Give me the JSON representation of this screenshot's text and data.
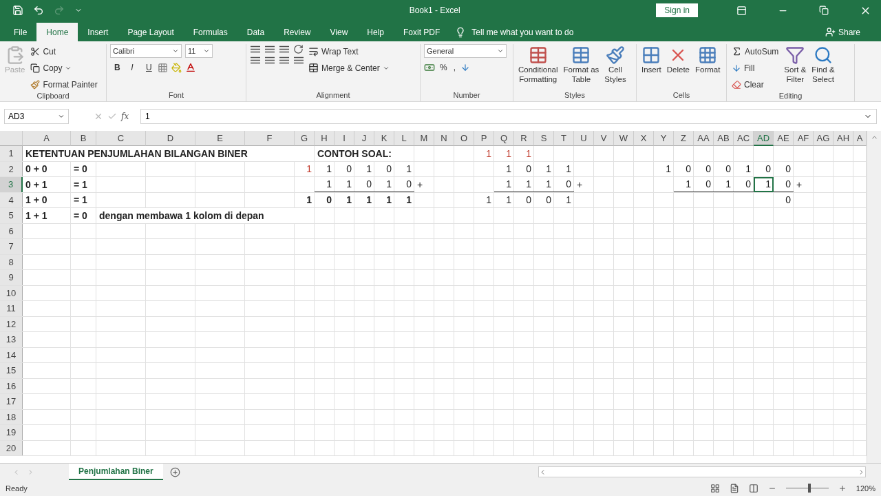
{
  "title_bar": {
    "title": "Book1  -  Excel",
    "sign_in": "Sign in"
  },
  "ribbon_tabs": [
    {
      "label": "File",
      "selected": false
    },
    {
      "label": "Home",
      "selected": true
    },
    {
      "label": "Insert",
      "selected": false
    },
    {
      "label": "Page Layout",
      "selected": false
    },
    {
      "label": "Formulas",
      "selected": false
    },
    {
      "label": "Data",
      "selected": false
    },
    {
      "label": "Review",
      "selected": false
    },
    {
      "label": "View",
      "selected": false
    },
    {
      "label": "Help",
      "selected": false
    },
    {
      "label": "Foxit PDF",
      "selected": false
    }
  ],
  "tell_me": "Tell me what you want to do",
  "share": "Share",
  "ribbon": {
    "clipboard": {
      "paste": {
        "label": "Paste",
        "disabled": true
      },
      "cut": "Cut",
      "copy": "Copy",
      "format_painter": "Format Painter",
      "label": "Clipboard"
    },
    "font": {
      "name": "Calibri",
      "size": "11",
      "bold": "B",
      "italic": "I",
      "underline": "U",
      "label": "Font"
    },
    "alignment": {
      "wrap_text": "Wrap Text",
      "merge_center": "Merge & Center",
      "label": "Alignment"
    },
    "number": {
      "format": "General",
      "percent": "%",
      "comma": ",",
      "label": "Number"
    },
    "styles": {
      "buttons": [
        {
          "lines": [
            "Conditional",
            "Formatting"
          ],
          "kind": "conditional"
        },
        {
          "lines": [
            "Format as",
            "Table"
          ],
          "kind": "table"
        },
        {
          "lines": [
            "Cell",
            "Styles"
          ],
          "kind": "styles"
        }
      ],
      "label": "Styles"
    },
    "cells": {
      "buttons": [
        {
          "lines": [
            "Insert"
          ],
          "kind": "insert"
        },
        {
          "lines": [
            "Delete"
          ],
          "kind": "delete"
        },
        {
          "lines": [
            "Format"
          ],
          "kind": "format"
        }
      ],
      "label": "Cells"
    },
    "editing": {
      "autosum": "AutoSum",
      "fill": "Fill",
      "clear": "Clear",
      "buttons": [
        {
          "lines": [
            "Sort &",
            "Filter"
          ],
          "kind": "sort"
        },
        {
          "lines": [
            "Find &",
            "Select"
          ],
          "kind": "find"
        }
      ],
      "label": "Editing"
    }
  },
  "formula_bar": {
    "name_box": "AD3",
    "function_label": "fx",
    "value": "1"
  },
  "sheet": {
    "columns": [
      {
        "label": "A",
        "selected": false
      },
      {
        "label": "B",
        "selected": false
      },
      {
        "label": "C",
        "selected": false
      },
      {
        "label": "D",
        "selected": false
      },
      {
        "label": "E",
        "selected": false
      },
      {
        "label": "F",
        "selected": false
      },
      {
        "label": "G",
        "selected": false
      },
      {
        "label": "H",
        "selected": false
      },
      {
        "label": "I",
        "selected": false
      },
      {
        "label": "J",
        "selected": false
      },
      {
        "label": "K",
        "selected": false
      },
      {
        "label": "L",
        "selected": false
      },
      {
        "label": "M",
        "selected": false
      },
      {
        "label": "N",
        "selected": false
      },
      {
        "label": "O",
        "selected": false
      },
      {
        "label": "P",
        "selected": false
      },
      {
        "label": "Q",
        "selected": false
      },
      {
        "label": "R",
        "selected": false
      },
      {
        "label": "S",
        "selected": false
      },
      {
        "label": "T",
        "selected": false
      },
      {
        "label": "U",
        "selected": false
      },
      {
        "label": "V",
        "selected": false
      },
      {
        "label": "W",
        "selected": false
      },
      {
        "label": "X",
        "selected": false
      },
      {
        "label": "Y",
        "selected": false
      },
      {
        "label": "Z",
        "selected": false
      },
      {
        "label": "AA",
        "selected": false
      },
      {
        "label": "AB",
        "selected": false
      },
      {
        "label": "AC",
        "selected": false
      },
      {
        "label": "AD",
        "selected": true
      },
      {
        "label": "AE",
        "selected": false
      },
      {
        "label": "AF",
        "selected": false
      },
      {
        "label": "AG",
        "selected": false
      },
      {
        "label": "AH",
        "selected": false
      },
      {
        "label": "A",
        "selected": false
      }
    ],
    "rows": [
      {
        "number": "1",
        "selected": false,
        "cells": [
          {
            "text": "KETENTUAN PENJUMLAHAN BILANGAN BINER",
            "kind": "text",
            "bold": true,
            "carry": false,
            "selected": false
          },
          {
            "text": "CONTOH SOAL:",
            "kind": "text",
            "bold": true,
            "carry": false,
            "selected": false
          },
          {
            "text": "1",
            "kind": "number",
            "bold": false,
            "carry": true,
            "selected": false
          },
          {
            "text": "1",
            "kind": "number",
            "bold": false,
            "carry": true,
            "selected": false
          },
          {
            "text": "1",
            "kind": "number",
            "bold": false,
            "carry": true,
            "selected": false
          }
        ]
      },
      {
        "number": "2",
        "selected": false,
        "cells": [
          {
            "text": "0 + 0",
            "kind": "text",
            "bold": true,
            "carry": false,
            "selected": false
          },
          {
            "text": "= 0",
            "kind": "text",
            "bold": true,
            "carry": false,
            "selected": false
          },
          {
            "text": "1",
            "kind": "number",
            "bold": false,
            "carry": true,
            "selected": false
          },
          {
            "text": "1",
            "kind": "number",
            "bold": false,
            "carry": false,
            "selected": false
          },
          {
            "text": "0",
            "kind": "number",
            "bold": false,
            "carry": false,
            "selected": false
          },
          {
            "text": "1",
            "kind": "number",
            "bold": false,
            "carry": false,
            "selected": false
          },
          {
            "text": "0",
            "kind": "number",
            "bold": false,
            "carry": false,
            "selected": false
          },
          {
            "text": "1",
            "kind": "number",
            "bold": false,
            "carry": false,
            "selected": false
          },
          {
            "text": "1",
            "kind": "number",
            "bold": false,
            "carry": false,
            "selected": false
          },
          {
            "text": "0",
            "kind": "number",
            "bold": false,
            "carry": false,
            "selected": false
          },
          {
            "text": "1",
            "kind": "number",
            "bold": false,
            "carry": false,
            "selected": false
          },
          {
            "text": "1",
            "kind": "number",
            "bold": false,
            "carry": false,
            "selected": false
          },
          {
            "text": "1",
            "kind": "number",
            "bold": false,
            "carry": false,
            "selected": false
          },
          {
            "text": "0",
            "kind": "number",
            "bold": false,
            "carry": false,
            "selected": false
          },
          {
            "text": "0",
            "kind": "number",
            "bold": false,
            "carry": false,
            "selected": false
          },
          {
            "text": "0",
            "kind": "number",
            "bold": false,
            "carry": false,
            "selected": false
          },
          {
            "text": "1",
            "kind": "number",
            "bold": false,
            "carry": false,
            "selected": false
          },
          {
            "text": "0",
            "kind": "number",
            "bold": false,
            "carry": false,
            "selected": false
          },
          {
            "text": "0",
            "kind": "number",
            "bold": false,
            "carry": false,
            "selected": false
          }
        ]
      },
      {
        "number": "3",
        "selected": true,
        "cells": [
          {
            "text": "0 + 1",
            "kind": "text",
            "bold": true,
            "carry": false,
            "selected": false,
            "underlined": false
          },
          {
            "text": "= 1",
            "kind": "text",
            "bold": true,
            "carry": false,
            "selected": false,
            "underlined": false
          },
          {
            "text": "1",
            "kind": "number",
            "bold": false,
            "carry": false,
            "selected": false,
            "underlined": true
          },
          {
            "text": "1",
            "kind": "number",
            "bold": false,
            "carry": false,
            "selected": false,
            "underlined": true
          },
          {
            "text": "0",
            "kind": "number",
            "bold": false,
            "carry": false,
            "selected": false,
            "underlined": true
          },
          {
            "text": "1",
            "kind": "number",
            "bold": false,
            "carry": false,
            "selected": false,
            "underlined": true
          },
          {
            "text": "0",
            "kind": "number",
            "bold": false,
            "carry": false,
            "selected": false,
            "underlined": true
          },
          {
            "text": "+",
            "kind": "text",
            "bold": false,
            "carry": false,
            "selected": false,
            "underlined": false
          },
          {
            "text": "1",
            "kind": "number",
            "bold": false,
            "carry": false,
            "selected": false,
            "underlined": true
          },
          {
            "text": "1",
            "kind": "number",
            "bold": false,
            "carry": false,
            "selected": false,
            "underlined": true
          },
          {
            "text": "1",
            "kind": "number",
            "bold": false,
            "carry": false,
            "selected": false,
            "underlined": true
          },
          {
            "text": "0",
            "kind": "number",
            "bold": false,
            "carry": false,
            "selected": false,
            "underlined": true
          },
          {
            "text": "+",
            "kind": "text",
            "bold": false,
            "carry": false,
            "selected": false,
            "underlined": false
          },
          {
            "text": "1",
            "kind": "number",
            "bold": false,
            "carry": false,
            "selected": false,
            "underlined": true
          },
          {
            "text": "0",
            "kind": "number",
            "bold": false,
            "carry": false,
            "selected": false,
            "underlined": true
          },
          {
            "text": "1",
            "kind": "number",
            "bold": false,
            "carry": false,
            "selected": false,
            "underlined": true
          },
          {
            "text": "0",
            "kind": "number",
            "bold": false,
            "carry": false,
            "selected": false,
            "underlined": true
          },
          {
            "text": "1",
            "kind": "number",
            "bold": false,
            "carry": false,
            "selected": true,
            "underlined": true
          },
          {
            "text": "0",
            "kind": "number",
            "bold": false,
            "carry": false,
            "selected": false,
            "underlined": true
          },
          {
            "text": "+",
            "kind": "text",
            "bold": false,
            "carry": false,
            "selected": false,
            "underlined": false
          }
        ]
      },
      {
        "number": "4",
        "selected": false,
        "cells": [
          {
            "text": "1 + 0",
            "kind": "text",
            "bold": true,
            "carry": false,
            "selected": false
          },
          {
            "text": "= 1",
            "kind": "text",
            "bold": true,
            "carry": false,
            "selected": false
          },
          {
            "text": "1",
            "kind": "number",
            "bold": true,
            "carry": false,
            "selected": false
          },
          {
            "text": "0",
            "kind": "number",
            "bold": true,
            "carry": false,
            "selected": false
          },
          {
            "text": "1",
            "kind": "number",
            "bold": true,
            "carry": false,
            "selected": false
          },
          {
            "text": "1",
            "kind": "number",
            "bold": true,
            "carry": false,
            "selected": false
          },
          {
            "text": "1",
            "kind": "number",
            "bold": true,
            "carry": false,
            "selected": false
          },
          {
            "text": "1",
            "kind": "number",
            "bold": true,
            "carry": false,
            "selected": false
          },
          {
            "text": "1",
            "kind": "number",
            "bold": false,
            "carry": false,
            "selected": false
          },
          {
            "text": "1",
            "kind": "number",
            "bold": false,
            "carry": false,
            "selected": false
          },
          {
            "text": "0",
            "kind": "number",
            "bold": false,
            "carry": false,
            "selected": false
          },
          {
            "text": "0",
            "kind": "number",
            "bold": false,
            "carry": false,
            "selected": false
          },
          {
            "text": "1",
            "kind": "number",
            "bold": false,
            "carry": false,
            "selected": false
          },
          {
            "text": "0",
            "kind": "number",
            "bold": false,
            "carry": false,
            "selected": false
          }
        ]
      },
      {
        "number": "5",
        "selected": false,
        "cells": [
          {
            "text": "1 + 1",
            "kind": "text",
            "bold": true,
            "carry": false,
            "selected": false
          },
          {
            "text": "= 0",
            "kind": "text",
            "bold": true,
            "carry": false,
            "selected": false
          },
          {
            "text": "dengan membawa 1 kolom di depan",
            "kind": "text",
            "bold": true,
            "carry": false,
            "selected": false
          }
        ]
      },
      {
        "number": "6",
        "selected": false
      },
      {
        "number": "7",
        "selected": false
      },
      {
        "number": "8",
        "selected": false
      },
      {
        "number": "9",
        "selected": false
      },
      {
        "number": "10",
        "selected": false
      },
      {
        "number": "11",
        "selected": false
      },
      {
        "number": "12",
        "selected": false
      },
      {
        "number": "13",
        "selected": false
      },
      {
        "number": "14",
        "selected": false
      },
      {
        "number": "15",
        "selected": false
      },
      {
        "number": "16",
        "selected": false
      },
      {
        "number": "17",
        "selected": false
      },
      {
        "number": "18",
        "selected": false
      },
      {
        "number": "19",
        "selected": false
      },
      {
        "number": "20",
        "selected": false
      }
    ]
  },
  "sheet_tabs": [
    {
      "label": "Penjumlahan Biner",
      "selected": true
    }
  ],
  "status_bar": {
    "status": "Ready",
    "zoom_slider": {
      "level": 0.55
    },
    "zoom": "120%"
  }
}
